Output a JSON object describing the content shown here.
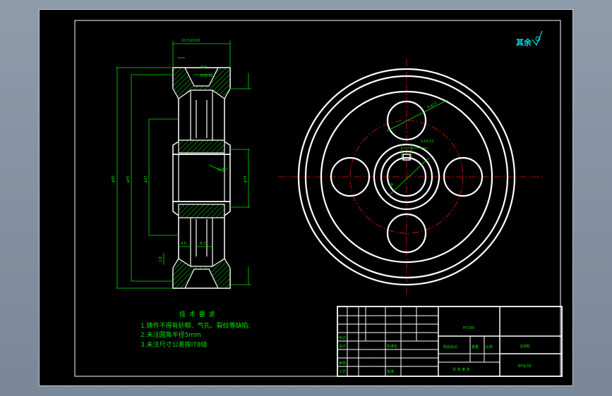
{
  "drawing": {
    "dimensions": {
      "top_width": "10.5±0.02",
      "angle": "34°",
      "groove": "R15.02",
      "dia_outer": "φ90",
      "dia_mid": "φ45",
      "dia_inner": "φ37",
      "dia_small": "φ34",
      "chamfer": "6x45°",
      "dim_a": "4.5",
      "dim_b": "8.3",
      "dim_c": "2.8",
      "hole_dia": "4-φ13",
      "hole_pos": "1±0.02",
      "pcd": "φ8"
    },
    "surface_note": "其余",
    "tech_req": {
      "title": "技 术 要 求",
      "items": [
        "1.铸件不得有砂眼、气孔、裂纹等缺陷;",
        "2.未注圆角半径5mm",
        "3.未注尺寸公差按IT8级"
      ]
    },
    "title_block": {
      "part_name": "主动轮",
      "drawing_no": "BYSJ-05",
      "material": "HT200",
      "scale_label": "比例",
      "mark_label": "标记",
      "designer_label": "设计",
      "std_label": "标准化",
      "review_label": "审核",
      "process_label": "工艺",
      "approve_label": "批准",
      "sheet_text": "共 张 第 张",
      "stage_label": "阶段标记",
      "weight_label": "重量",
      "ratio_label": "比例"
    }
  }
}
